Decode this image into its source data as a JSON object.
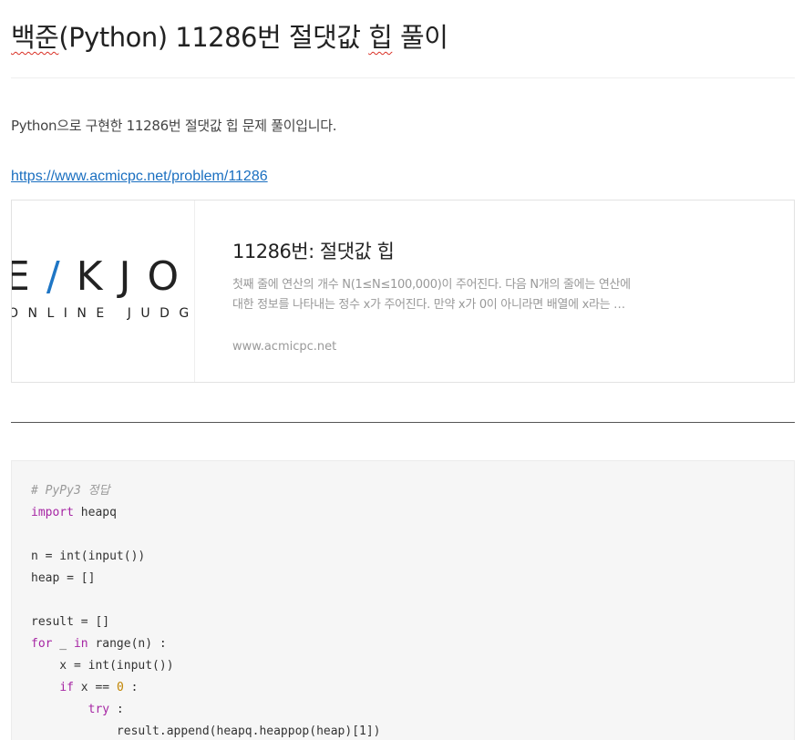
{
  "post": {
    "title_part1": "백준",
    "title_part2": "(Python) 11286번 절댓값 ",
    "title_part3": "힙",
    "title_part4": " 풀이",
    "intro": "Python으로 구현한 11286번 절댓값 힙 문제 풀이입니다.",
    "link": "https://www.acmicpc.net/problem/11286"
  },
  "card": {
    "logo_big_1": "E",
    "logo_slash": "/",
    "logo_big_2": "KJOO",
    "logo_small": "ONLINE JUDGE",
    "title": "11286번: 절댓값 힙",
    "desc_line1": "첫째 줄에 연산의 개수 N(1≤N≤100,000)이 주어진다. 다음 N개의 줄에는 연산에",
    "desc_line2": "대한 정보를 나타내는 정수 x가 주어진다. 만약 x가 0이 아니라면 배열에 x라는 …",
    "url": "www.acmicpc.net"
  },
  "code": {
    "l1": "# PyPy3 정답",
    "l2_kw": "import",
    "l2_rest": " heapq",
    "l4": "n = int(input())",
    "l5": "heap = []",
    "l7": "result = []",
    "l8_kw1": "for",
    "l8_a": " _ ",
    "l8_kw2": "in",
    "l8_b": " range(n) :",
    "l9": "    x = int(input())",
    "l10_indent": "    ",
    "l10_kw": "if",
    "l10_a": " x == ",
    "l10_num": "0",
    "l10_b": " :",
    "l11_indent": "        ",
    "l11_kw": "try",
    "l11_b": " :",
    "l12": "            result.append(heapq.heappop(heap)[1])"
  },
  "colors": {
    "link": "#1a6fc0",
    "keyword": "#a626a4",
    "number": "#c18401",
    "comment": "#999999",
    "logo_accent": "#1f76c5"
  }
}
